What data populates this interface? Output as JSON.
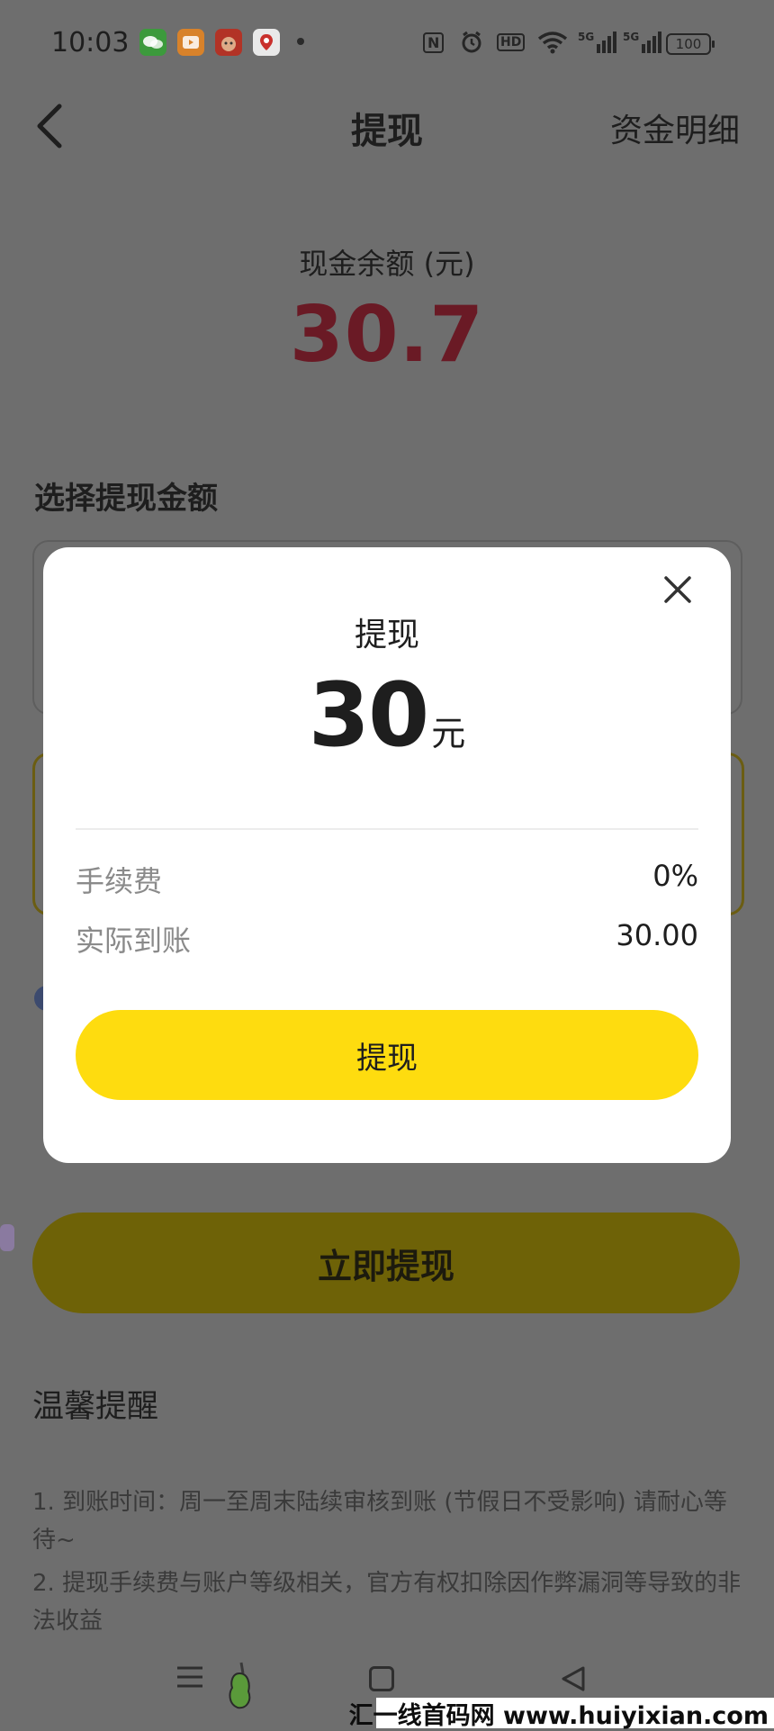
{
  "status_bar": {
    "time": "10:03",
    "app_icons": [
      "wechat-icon",
      "video-app-icon",
      "cow-app-icon",
      "map-app-icon"
    ],
    "nfc": "N",
    "hd": "HD",
    "signal_1": "5G",
    "signal_2": "5G",
    "battery": "100"
  },
  "header": {
    "title": "提现",
    "right_link": "资金明细"
  },
  "balance": {
    "label": "现金余额 (元)",
    "value": "30.7"
  },
  "choose_label": "选择提现金额",
  "withdraw_now_label": "立即提现",
  "tips": {
    "title": "温馨提醒",
    "items": [
      "1. 到账时间：周一至周末陆续审核到账 (节假日不受影响) 请耐心等待~",
      " 2. 提现手续费与账户等级相关，官方有权扣除因作弊漏洞等导致的非法收益"
    ]
  },
  "modal": {
    "title": "提现",
    "amount": "30",
    "unit": "元",
    "fee_label": "手续费",
    "fee_value": "0%",
    "actual_label": "实际到账",
    "actual_value": "30.00",
    "button_label": "提现"
  },
  "watermark": "汇一线首码网 www.huiyixian.com",
  "colors": {
    "accent_yellow": "#fedc0f",
    "balance_red": "#6a1a25",
    "overlay_gray": "#6e6e6e"
  }
}
